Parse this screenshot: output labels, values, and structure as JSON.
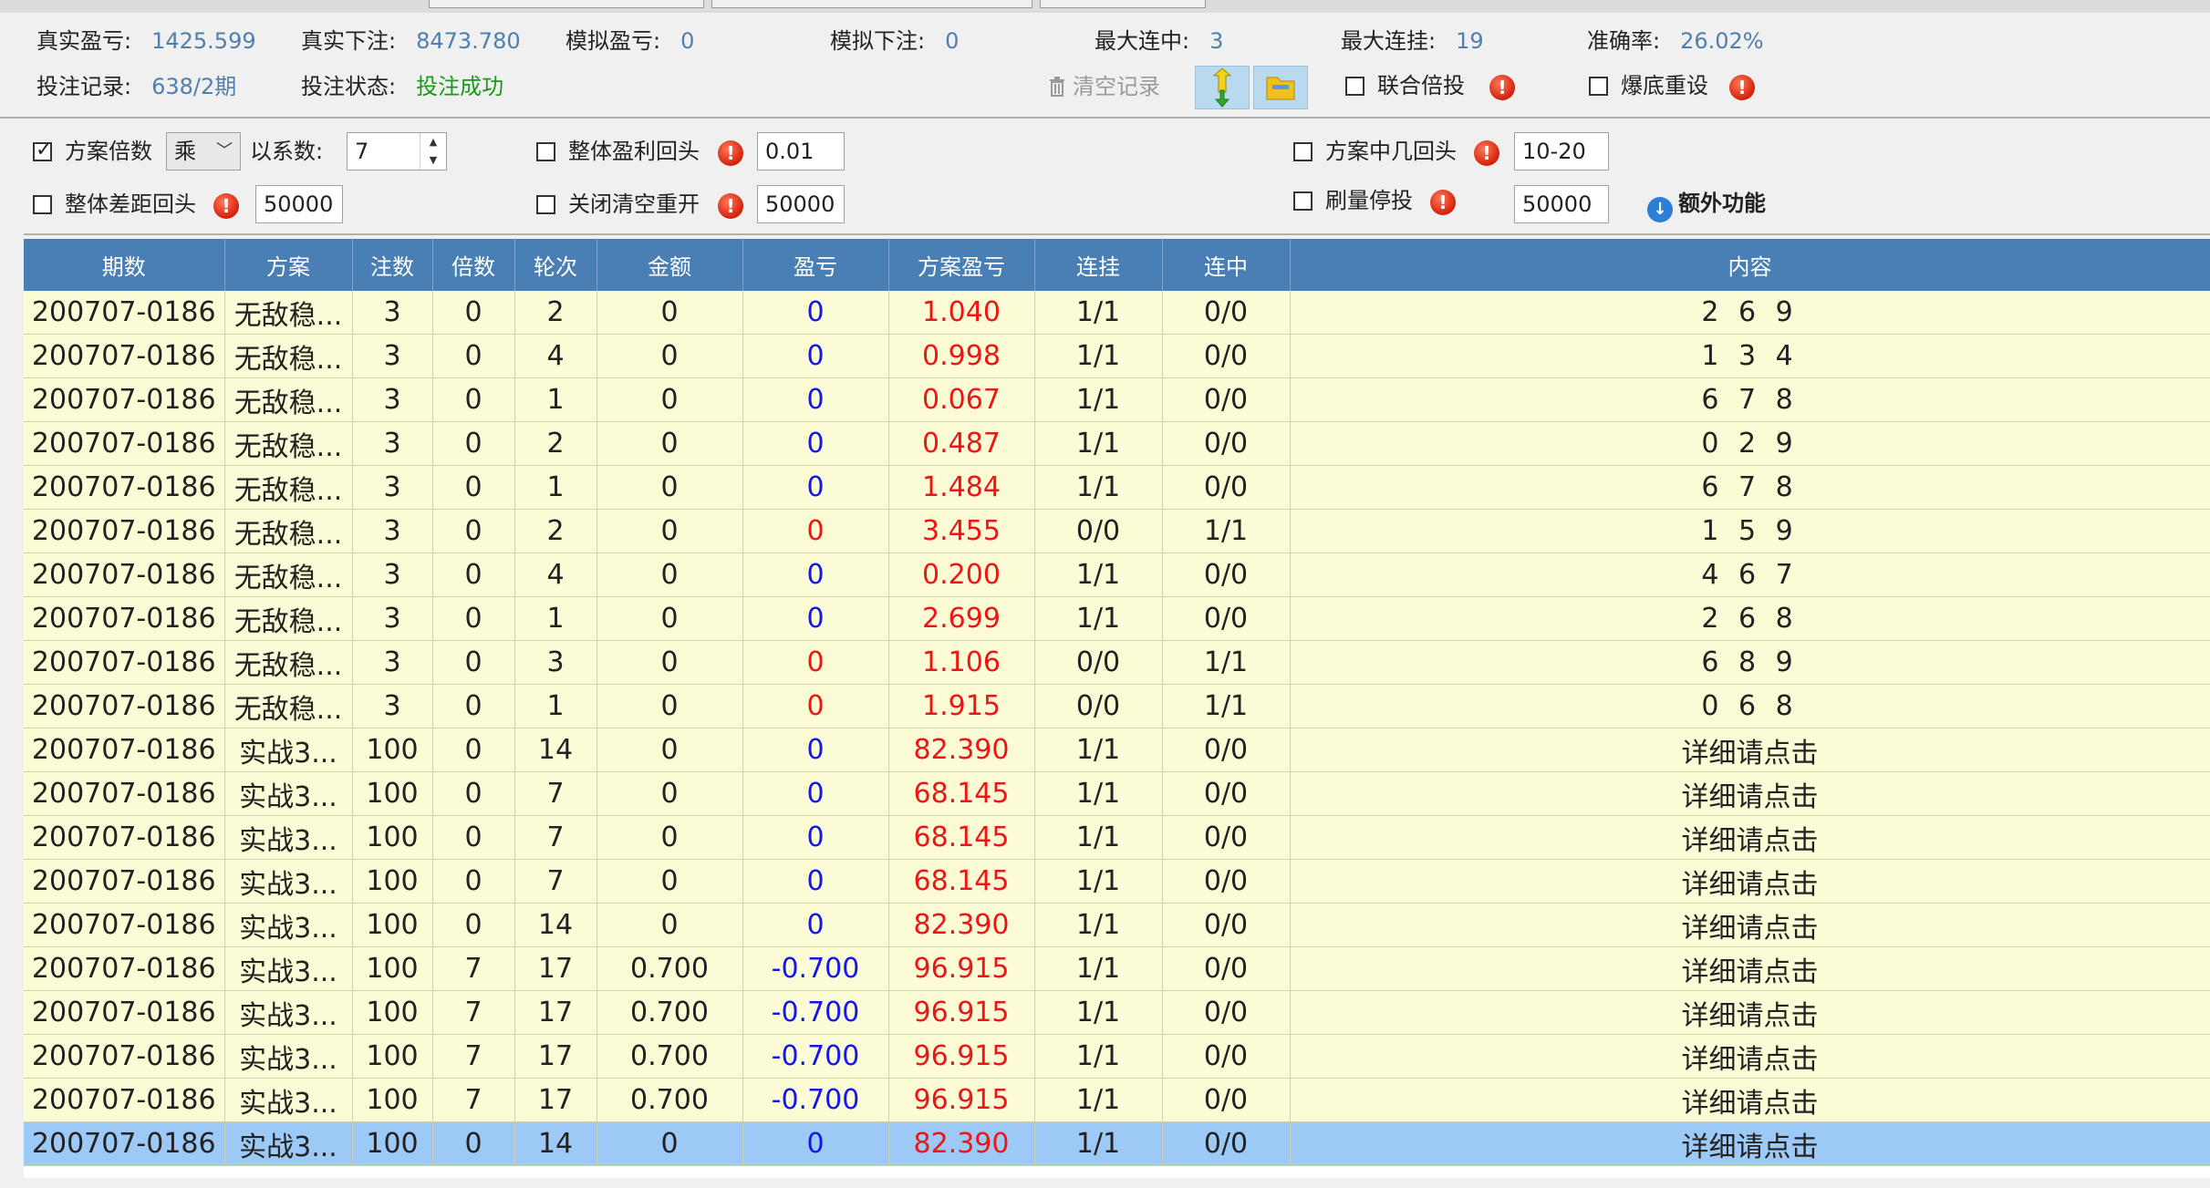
{
  "stats": {
    "real_pnl_label": "真实盈亏:",
    "real_pnl": "1425.599",
    "real_bet_label": "真实下注:",
    "real_bet": "8473.780",
    "sim_pnl_label": "模拟盈亏:",
    "sim_pnl": "0",
    "sim_bet_label": "模拟下注:",
    "sim_bet": "0",
    "max_win_label": "最大连中:",
    "max_win": "3",
    "max_loss_label": "最大连挂:",
    "max_loss": "19",
    "accuracy_label": "准确率:",
    "accuracy": "26.02%",
    "records_label": "投注记录:",
    "records": "638/2期",
    "status_label": "投注状态:",
    "status": "投注成功"
  },
  "toolbar": {
    "clear_label": "清空记录",
    "joint_multiply_label": "联合倍投",
    "bust_reset_label": "爆底重设"
  },
  "options": {
    "plan_multiple_label": "方案倍数",
    "operator_value": "乘",
    "coefficient_label": "以系数:",
    "coefficient_value": "7",
    "overall_profit_return_label": "整体盈利回头",
    "overall_profit_return_value": "0.01",
    "plan_hit_return_label": "方案中几回头",
    "plan_hit_return_value": "10-20",
    "overall_gap_return_label": "整体差距回头",
    "overall_gap_return_value": "50000",
    "close_clear_restart_label": "关闭清空重开",
    "close_clear_restart_value": "50000",
    "volume_stop_label": "刷量停投",
    "volume_stop_value": "50000",
    "extra_features_label": "额外功能"
  },
  "table": {
    "columns": [
      "期数",
      "方案",
      "注数",
      "倍数",
      "轮次",
      "金额",
      "盈亏",
      "方案盈亏",
      "连挂",
      "连中",
      "内容"
    ],
    "rows": [
      [
        "200707-0186",
        "无敌稳...",
        "3",
        "0",
        "2",
        "0",
        "0",
        "1.040",
        "1/1",
        "0/0",
        "2 6 9"
      ],
      [
        "200707-0186",
        "无敌稳...",
        "3",
        "0",
        "4",
        "0",
        "0",
        "0.998",
        "1/1",
        "0/0",
        "1 3 4"
      ],
      [
        "200707-0186",
        "无敌稳...",
        "3",
        "0",
        "1",
        "0",
        "0",
        "0.067",
        "1/1",
        "0/0",
        "6 7 8"
      ],
      [
        "200707-0186",
        "无敌稳...",
        "3",
        "0",
        "2",
        "0",
        "0",
        "0.487",
        "1/1",
        "0/0",
        "0 2 9"
      ],
      [
        "200707-0186",
        "无敌稳...",
        "3",
        "0",
        "1",
        "0",
        "0",
        "1.484",
        "1/1",
        "0/0",
        "6 7 8"
      ],
      [
        "200707-0186",
        "无敌稳...",
        "3",
        "0",
        "2",
        "0",
        "0",
        "3.455",
        "0/0",
        "1/1",
        "1 5 9"
      ],
      [
        "200707-0186",
        "无敌稳...",
        "3",
        "0",
        "4",
        "0",
        "0",
        "0.200",
        "1/1",
        "0/0",
        "4 6 7"
      ],
      [
        "200707-0186",
        "无敌稳...",
        "3",
        "0",
        "1",
        "0",
        "0",
        "2.699",
        "1/1",
        "0/0",
        "2 6 8"
      ],
      [
        "200707-0186",
        "无敌稳...",
        "3",
        "0",
        "3",
        "0",
        "0",
        "1.106",
        "0/0",
        "1/1",
        "6 8 9"
      ],
      [
        "200707-0186",
        "无敌稳...",
        "3",
        "0",
        "1",
        "0",
        "0",
        "1.915",
        "0/0",
        "1/1",
        "0 6 8"
      ],
      [
        "200707-0186",
        "实战3...",
        "100",
        "0",
        "14",
        "0",
        "0",
        "82.390",
        "1/1",
        "0/0",
        "详细请点击"
      ],
      [
        "200707-0186",
        "实战3...",
        "100",
        "0",
        "7",
        "0",
        "0",
        "68.145",
        "1/1",
        "0/0",
        "详细请点击"
      ],
      [
        "200707-0186",
        "实战3...",
        "100",
        "0",
        "7",
        "0",
        "0",
        "68.145",
        "1/1",
        "0/0",
        "详细请点击"
      ],
      [
        "200707-0186",
        "实战3...",
        "100",
        "0",
        "7",
        "0",
        "0",
        "68.145",
        "1/1",
        "0/0",
        "详细请点击"
      ],
      [
        "200707-0186",
        "实战3...",
        "100",
        "0",
        "14",
        "0",
        "0",
        "82.390",
        "1/1",
        "0/0",
        "详细请点击"
      ],
      [
        "200707-0186",
        "实战3...",
        "100",
        "7",
        "17",
        "0.700",
        "-0.700",
        "96.915",
        "1/1",
        "0/0",
        "详细请点击"
      ],
      [
        "200707-0186",
        "实战3...",
        "100",
        "7",
        "17",
        "0.700",
        "-0.700",
        "96.915",
        "1/1",
        "0/0",
        "详细请点击"
      ],
      [
        "200707-0186",
        "实战3...",
        "100",
        "7",
        "17",
        "0.700",
        "-0.700",
        "96.915",
        "1/1",
        "0/0",
        "详细请点击"
      ],
      [
        "200707-0186",
        "实战3...",
        "100",
        "7",
        "17",
        "0.700",
        "-0.700",
        "96.915",
        "1/1",
        "0/0",
        "详细请点击"
      ],
      [
        "200707-0186",
        "实战3...",
        "100",
        "0",
        "14",
        "0",
        "0",
        "82.390",
        "1/1",
        "0/0",
        "详细请点击"
      ]
    ],
    "pnl_colors": [
      "blue",
      "blue",
      "blue",
      "blue",
      "blue",
      "red",
      "blue",
      "blue",
      "red",
      "red",
      "blue",
      "blue",
      "blue",
      "blue",
      "blue",
      "blue",
      "blue",
      "blue",
      "blue",
      "blue"
    ],
    "selected_row": 19
  },
  "colors": {
    "header_bg": "#4a7fb5",
    "row_bg": "#fbfbd6",
    "selected_bg": "#9cc9f5",
    "value_blue": "#4f7fae",
    "status_green": "#1a9a1a",
    "pnl_red": "#ee1515",
    "pnl_blue": "#1515ee"
  },
  "icons": {
    "upload_arrow": "upload-arrow-icon",
    "folder": "folder-icon",
    "trash": "trash-icon",
    "warning": "warning-icon",
    "download_circle": "download-circle-icon"
  }
}
